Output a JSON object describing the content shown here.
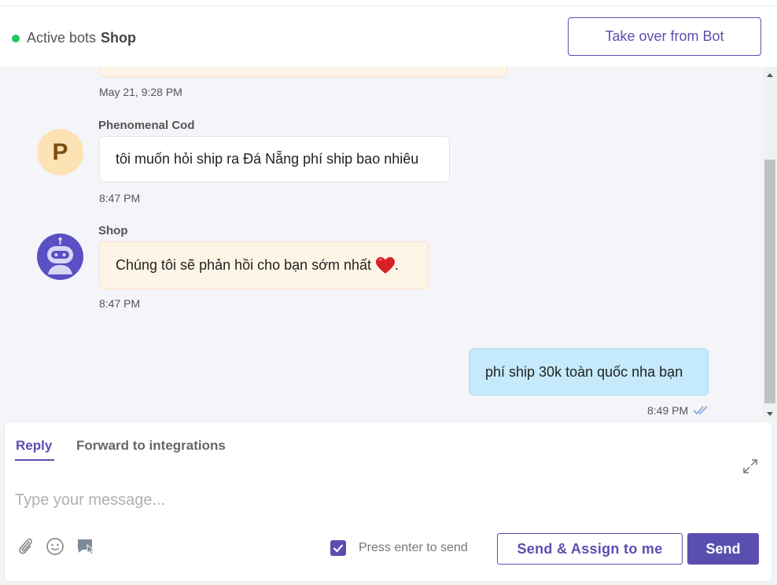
{
  "header": {
    "status_prefix": "Active bots",
    "bot_name": "Shop",
    "takeover_label": "Take over from Bot",
    "status_color": "#22c55e"
  },
  "messages": [
    {
      "time": "May 21, 9:28 PM"
    },
    {
      "sender": "Phenomenal Cod",
      "avatar_letter": "P",
      "text": "tôi muốn hỏi ship ra Đá Nẵng phí ship bao nhiêu",
      "time": "8:47 PM"
    },
    {
      "sender": "Shop",
      "text": "Chúng tôi sẽ phản hồi cho bạn sớm nhất",
      "emoji": "❤️",
      "suffix": ".",
      "time": "8:47 PM"
    },
    {
      "text": "phí ship 30k toàn quốc nha bạn",
      "time": "8:49 PM"
    }
  ],
  "composer": {
    "tabs": [
      {
        "label": "Reply"
      },
      {
        "label": "Forward to integrations"
      }
    ],
    "placeholder": "Type your message...",
    "press_enter_label": "Press enter to send",
    "send_assign_label": "Send & Assign to me",
    "send_label": "Send"
  },
  "colors": {
    "accent": "#5a4fb0",
    "agent_bubble": "#c4eafb",
    "bot_bubble": "#fff5e6"
  }
}
